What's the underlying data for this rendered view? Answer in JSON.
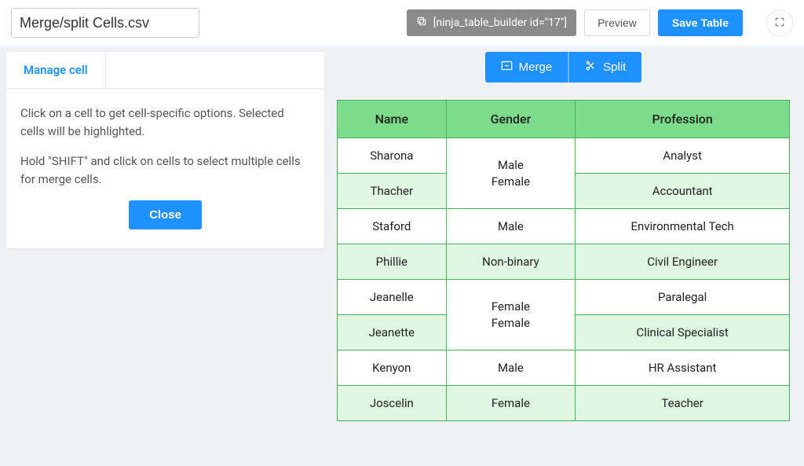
{
  "header": {
    "title_value": "Merge/split Cells.csv",
    "shortcode_text": "[ninja_table_builder id=\"17\"]",
    "preview_label": "Preview",
    "save_label": "Save Table"
  },
  "sidebar": {
    "tab_label": "Manage cell",
    "help_line1": "Click on a cell to get cell-specific options. Selected cells will be highlighted.",
    "help_line2": "Hold \"SHIFT\" and click on cells to select multiple cells for merge cells.",
    "close_label": "Close"
  },
  "table_actions": {
    "merge_label": "Merge",
    "split_label": "Split"
  },
  "table": {
    "headers": [
      "Name",
      "Gender",
      "Profession"
    ],
    "merged_gender_1": "Male\nFemale",
    "merged_gender_2": "Female\nFemale",
    "rows": [
      {
        "name": "Sharona",
        "profession": "Analyst",
        "alt": false
      },
      {
        "name": "Thacher",
        "profession": "Accountant",
        "alt": true
      },
      {
        "name": "Staford",
        "gender": "Male",
        "profession": "Environmental Tech",
        "alt": false
      },
      {
        "name": "Phillie",
        "gender": "Non-binary",
        "profession": "Civil Engineer",
        "alt": true
      },
      {
        "name": "Jeanelle",
        "profession": "Paralegal",
        "alt": false
      },
      {
        "name": "Jeanette",
        "profession": "Clinical Specialist",
        "alt": true
      },
      {
        "name": "Kenyon",
        "gender": "Male",
        "profession": "HR Assistant",
        "alt": false
      },
      {
        "name": "Joscelin",
        "gender": "Female",
        "profession": "Teacher",
        "alt": true
      }
    ]
  }
}
